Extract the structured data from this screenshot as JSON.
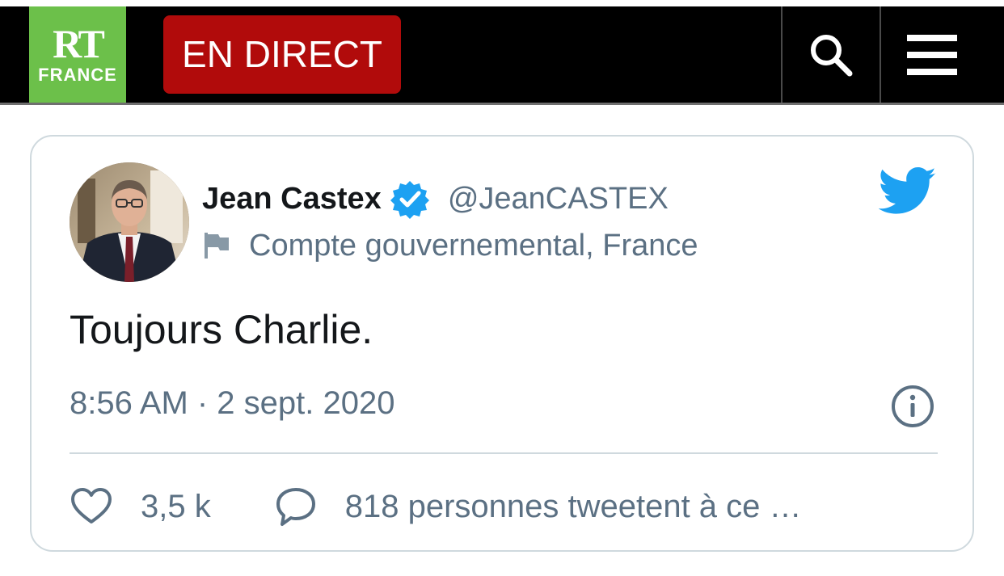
{
  "header": {
    "logo": {
      "line1": "RT",
      "line2": "FRANCE",
      "color": "#6cc04a"
    },
    "live_button": {
      "label": "EN DIRECT",
      "color": "#b10b0b"
    },
    "search_icon": "search-icon",
    "menu_icon": "hamburger-menu-icon"
  },
  "tweet": {
    "author": {
      "name": "Jean Castex",
      "handle": "@JeanCASTEX",
      "verified": true,
      "label": "Compte gouvernemental, France"
    },
    "text": "Toujours Charlie.",
    "timestamp": "8:56 AM · 2 sept. 2020",
    "likes": "3,5 k",
    "replies_text": "818 personnes tweetent à ce …",
    "brand_color": "#1da1f2"
  }
}
